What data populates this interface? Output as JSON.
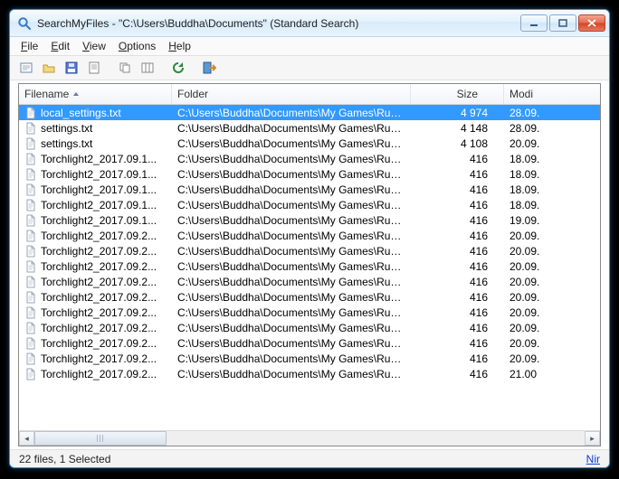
{
  "title": "SearchMyFiles -  \"C:\\Users\\Buddha\\Documents\"  (Standard Search)",
  "menu": {
    "file": "File",
    "edit": "Edit",
    "view": "View",
    "options": "Options",
    "help": "Help"
  },
  "columns": {
    "filename": "Filename",
    "folder": "Folder",
    "size": "Size",
    "modified": "Modi"
  },
  "folder_text": "C:\\Users\\Buddha\\Documents\\My Games\\Runic Ga...",
  "rows": [
    {
      "name": "local_settings.txt",
      "size": "4 974",
      "mod": "28.09.",
      "selected": true
    },
    {
      "name": "settings.txt",
      "size": "4 148",
      "mod": "28.09."
    },
    {
      "name": "settings.txt",
      "size": "4 108",
      "mod": "20.09."
    },
    {
      "name": "Torchlight2_2017.09.1...",
      "size": "416",
      "mod": "18.09."
    },
    {
      "name": "Torchlight2_2017.09.1...",
      "size": "416",
      "mod": "18.09."
    },
    {
      "name": "Torchlight2_2017.09.1...",
      "size": "416",
      "mod": "18.09."
    },
    {
      "name": "Torchlight2_2017.09.1...",
      "size": "416",
      "mod": "18.09."
    },
    {
      "name": "Torchlight2_2017.09.1...",
      "size": "416",
      "mod": "19.09."
    },
    {
      "name": "Torchlight2_2017.09.2...",
      "size": "416",
      "mod": "20.09."
    },
    {
      "name": "Torchlight2_2017.09.2...",
      "size": "416",
      "mod": "20.09."
    },
    {
      "name": "Torchlight2_2017.09.2...",
      "size": "416",
      "mod": "20.09."
    },
    {
      "name": "Torchlight2_2017.09.2...",
      "size": "416",
      "mod": "20.09."
    },
    {
      "name": "Torchlight2_2017.09.2...",
      "size": "416",
      "mod": "20.09."
    },
    {
      "name": "Torchlight2_2017.09.2...",
      "size": "416",
      "mod": "20.09."
    },
    {
      "name": "Torchlight2_2017.09.2...",
      "size": "416",
      "mod": "20.09."
    },
    {
      "name": "Torchlight2_2017.09.2...",
      "size": "416",
      "mod": "20.09."
    },
    {
      "name": "Torchlight2_2017.09.2...",
      "size": "416",
      "mod": "20.09."
    },
    {
      "name": "Torchlight2_2017.09.2...",
      "size": "416",
      "mod": "21.00"
    }
  ],
  "status": "22 files, 1 Selected",
  "brand": "Nir"
}
